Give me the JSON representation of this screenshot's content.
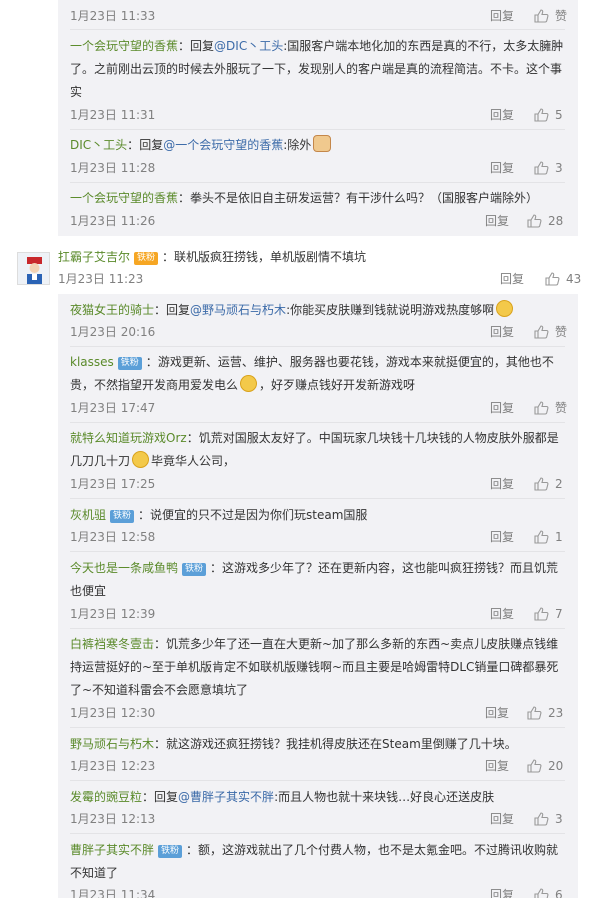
{
  "ui": {
    "reply_label": "回复",
    "like_label": "赞",
    "colon": "："
  },
  "comments": [
    {
      "user": "",
      "text": "",
      "time": "1月23日 11:33",
      "likes": "赞"
    },
    {
      "user": "一个会玩守望的香蕉",
      "reply_prefix": "回复",
      "mention": "@DIC丶工头",
      "text": ":国服客户端本地化加的东西是真的不行，太多太臃肿了。之前刚出云顶的时候去外服玩了一下，发现别人的客户端是真的流程简洁。不卡。这个事实",
      "time": "1月23日 11:31",
      "likes": "5"
    },
    {
      "user": "DIC丶工头",
      "reply_prefix": "回复",
      "mention": "@一个会玩守望的香蕉",
      "text": ":除外",
      "time": "1月23日 11:28",
      "likes": "3"
    },
    {
      "user": "一个会玩守望的香蕉",
      "text": "拳头不是依旧自主研发运营？有干涉什么吗？（国服客户端除外）",
      "time": "1月23日 11:26",
      "likes": "28"
    },
    {
      "user": "扛霸子艾吉尔",
      "badge": "铁粉",
      "text": "联机版疯狂捞钱，单机版剧情不填坑",
      "time": "1月23日 11:23",
      "likes": "43"
    },
    {
      "user": "夜猫女王的骑士",
      "reply_prefix": "回复",
      "mention": "@野马顽石与朽木",
      "text": ":你能买皮肤赚到钱就说明游戏热度够啊",
      "time": "1月23日 20:16",
      "likes": "赞"
    },
    {
      "user": "klasses",
      "badge": "铁粉",
      "text_a": "游戏更新、运营、维护、服务器也要花钱，游戏本来就挺便宜的，其他也不贵，不然指望开发商用爱发电么",
      "text_b": "，好歹赚点钱好开发新游戏呀",
      "time": "1月23日 17:47",
      "likes": "赞"
    },
    {
      "user": "就特么知道玩游戏Orz",
      "text_a": "饥荒对国服太友好了。中国玩家几块钱十几块钱的人物皮肤外服都是几刀几十刀",
      "text_b": "毕竟华人公司，",
      "time": "1月23日 17:25",
      "likes": "2"
    },
    {
      "user": "灰机驵",
      "badge": "铁粉",
      "text": "说便宜的只不过是因为你们玩steam国服",
      "time": "1月23日 12:58",
      "likes": "1"
    },
    {
      "user": "今天也是一条咸鱼鸭",
      "badge": "铁粉",
      "text": "这游戏多少年了？还在更新内容，这也能叫疯狂捞钱？而且饥荒也便宜",
      "time": "1月23日 12:39",
      "likes": "7"
    },
    {
      "user": "白裤裆寒冬壹击",
      "text": "饥荒多少年了还一直在大更新~加了那么多新的东西~卖点儿皮肤赚点钱维持运营挺好的~至于单机版肯定不如联机版赚钱啊~而且主要是哈姆雷特DLC销量口碑都暴死了~不知道科雷会不会愿意填坑了",
      "time": "1月23日 12:30",
      "likes": "23"
    },
    {
      "user": "野马顽石与朽木",
      "text": "就这游戏还疯狂捞钱？我挂机得皮肤还在Steam里倒赚了几十块。",
      "time": "1月23日 12:23",
      "likes": "20"
    },
    {
      "user": "发霉的豌豆粒",
      "reply_prefix": "回复",
      "mention": "@曹胖子其实不胖",
      "text": ":而且人物也就十来块钱…好良心还送皮肤",
      "time": "1月23日 12:13",
      "likes": "3"
    },
    {
      "user": "曹胖子其实不胖",
      "badge": "铁粉",
      "text": "额，这游戏就出了几个付费人物，也不是太氪金吧。不过腾讯收购就不知道了",
      "time": "1月23日 11:34",
      "likes": "6"
    }
  ]
}
